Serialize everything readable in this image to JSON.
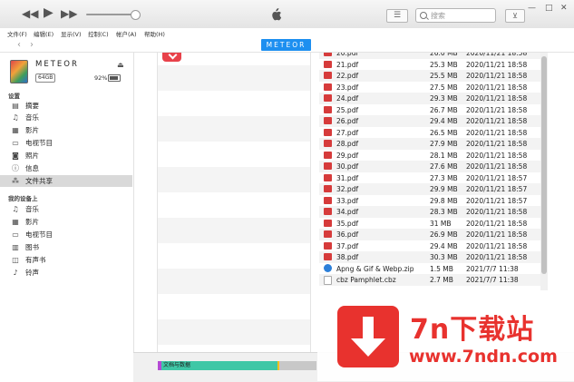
{
  "toolbar": {
    "search_placeholder": "搜索",
    "rewind_icon": "◀◀",
    "play_icon": "▶",
    "forward_icon": "▶▶",
    "list_icon": "☰",
    "download_icon": "⊻",
    "minimize_icon": "—",
    "maximize_icon": "□",
    "close_icon": "✕"
  },
  "menu": {
    "file": "文件(F)",
    "edit": "编辑(E)",
    "view": "显示(V)",
    "controls": "控制(C)",
    "account": "帐户(A)",
    "help": "帮助(H)"
  },
  "nav": {
    "back": "‹",
    "forward": "›",
    "device_tab": "METEOR"
  },
  "device": {
    "name": "METEOR",
    "capacity": "64GB",
    "battery": "92%",
    "eject": "⏏"
  },
  "sidebar": {
    "settings_header": "设置",
    "settings_items": [
      {
        "label": "摘要",
        "icon": "▤"
      },
      {
        "label": "音乐",
        "icon": "♫"
      },
      {
        "label": "影片",
        "icon": "▦"
      },
      {
        "label": "电视节目",
        "icon": "▭"
      },
      {
        "label": "照片",
        "icon": "◙"
      },
      {
        "label": "信息",
        "icon": "ⓘ"
      },
      {
        "label": "文件共享",
        "icon": "⁂"
      }
    ],
    "device_header": "我的设备上",
    "device_items": [
      {
        "label": "音乐",
        "icon": "♫"
      },
      {
        "label": "影片",
        "icon": "▦"
      },
      {
        "label": "电视节目",
        "icon": "▭"
      },
      {
        "label": "图书",
        "icon": "▥"
      },
      {
        "label": "有声书",
        "icon": "◫"
      },
      {
        "label": "铃声",
        "icon": "♪"
      }
    ]
  },
  "files": [
    {
      "name": "20.pdf",
      "size": "26.0 MB",
      "date": "2020/11/21 18:58",
      "type": "pdf"
    },
    {
      "name": "21.pdf",
      "size": "25.3 MB",
      "date": "2020/11/21 18:58",
      "type": "pdf"
    },
    {
      "name": "22.pdf",
      "size": "25.5 MB",
      "date": "2020/11/21 18:58",
      "type": "pdf"
    },
    {
      "name": "23.pdf",
      "size": "27.5 MB",
      "date": "2020/11/21 18:58",
      "type": "pdf"
    },
    {
      "name": "24.pdf",
      "size": "29.3 MB",
      "date": "2020/11/21 18:58",
      "type": "pdf"
    },
    {
      "name": "25.pdf",
      "size": "26.7 MB",
      "date": "2020/11/21 18:58",
      "type": "pdf"
    },
    {
      "name": "26.pdf",
      "size": "29.4 MB",
      "date": "2020/11/21 18:58",
      "type": "pdf"
    },
    {
      "name": "27.pdf",
      "size": "26.5 MB",
      "date": "2020/11/21 18:58",
      "type": "pdf"
    },
    {
      "name": "28.pdf",
      "size": "27.9 MB",
      "date": "2020/11/21 18:58",
      "type": "pdf"
    },
    {
      "name": "29.pdf",
      "size": "28.1 MB",
      "date": "2020/11/21 18:58",
      "type": "pdf"
    },
    {
      "name": "30.pdf",
      "size": "27.6 MB",
      "date": "2020/11/21 18:58",
      "type": "pdf"
    },
    {
      "name": "31.pdf",
      "size": "27.3 MB",
      "date": "2020/11/21 18:57",
      "type": "pdf"
    },
    {
      "name": "32.pdf",
      "size": "29.9 MB",
      "date": "2020/11/21 18:57",
      "type": "pdf"
    },
    {
      "name": "33.pdf",
      "size": "29.8 MB",
      "date": "2020/11/21 18:57",
      "type": "pdf"
    },
    {
      "name": "34.pdf",
      "size": "28.3 MB",
      "date": "2020/11/21 18:58",
      "type": "pdf"
    },
    {
      "name": "35.pdf",
      "size": "31 MB",
      "date": "2020/11/21 18:58",
      "type": "pdf"
    },
    {
      "name": "36.pdf",
      "size": "26.9 MB",
      "date": "2020/11/21 18:58",
      "type": "pdf"
    },
    {
      "name": "37.pdf",
      "size": "29.4 MB",
      "date": "2020/11/21 18:58",
      "type": "pdf"
    },
    {
      "name": "38.pdf",
      "size": "30.3 MB",
      "date": "2020/11/21 18:58",
      "type": "pdf"
    },
    {
      "name": "Apng & Gif & Webp.zip",
      "size": "1.5 MB",
      "date": "2021/7/7 11:38",
      "type": "zip"
    },
    {
      "name": "cbz Pamphlet.cbz",
      "size": "2.7 MB",
      "date": "2021/7/7 11:38",
      "type": "cbz"
    }
  ],
  "storage": {
    "label": "文档与数据"
  },
  "watermark": {
    "brand": "7n下载站",
    "url": "www.7ndn.com"
  },
  "colors": {
    "accent": "#1d8ff0",
    "watermark": "#e8322e"
  }
}
